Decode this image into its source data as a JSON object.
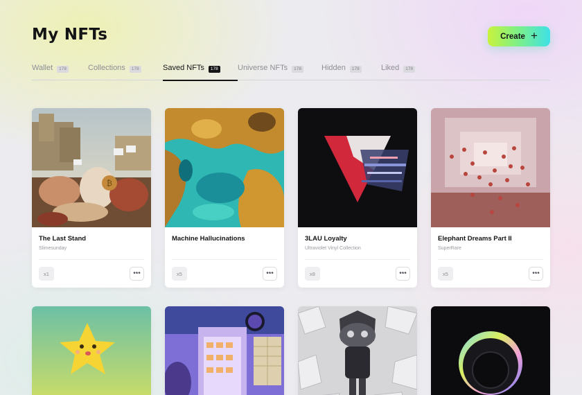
{
  "header": {
    "title": "My NFTs",
    "create_label": "Create",
    "create_icon": "plus-icon"
  },
  "tabs": [
    {
      "label": "Wallet",
      "count": "178",
      "active": false
    },
    {
      "label": "Collections",
      "count": "178",
      "active": false
    },
    {
      "label": "Saved NFTs",
      "count": "178",
      "active": true
    },
    {
      "label": "Universe NFTs",
      "count": "178",
      "active": false
    },
    {
      "label": "Hidden",
      "count": "178",
      "active": false
    },
    {
      "label": "Liked",
      "count": "178",
      "active": false
    }
  ],
  "cards": [
    {
      "name": "The Last Stand",
      "creator": "Slimesunday",
      "quantity": "x1",
      "art": "classical-battle-painting"
    },
    {
      "name": "Machine Hallucinations",
      "creator": "",
      "quantity": "x5",
      "art": "teal-orange-abstract"
    },
    {
      "name": "3LAU Loyalty",
      "creator": "Ultraviolet Vinyl Collection",
      "quantity": "x8",
      "art": "glitch-triangle"
    },
    {
      "name": "Elephant Dreams Part II",
      "creator": "SuperRare",
      "quantity": "x5",
      "art": "floating-spheres-room"
    },
    {
      "name": "",
      "creator": "",
      "quantity": "",
      "art": "smiling-star"
    },
    {
      "name": "",
      "creator": "",
      "quantity": "",
      "art": "neon-vending-machine"
    },
    {
      "name": "",
      "creator": "",
      "quantity": "",
      "art": "crystal-cat-figure"
    },
    {
      "name": "",
      "creator": "",
      "quantity": "",
      "art": "holographic-ring"
    }
  ]
}
